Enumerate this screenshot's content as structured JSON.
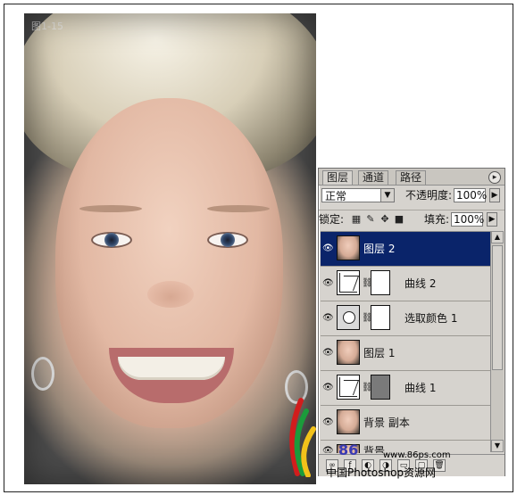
{
  "photo": {
    "label": "图1-15"
  },
  "layers_panel": {
    "tabs": [
      {
        "label": "图层",
        "active": true
      },
      {
        "label": "通道",
        "active": false
      },
      {
        "label": "路径",
        "active": false
      }
    ],
    "menu_icon": "panel-menu-icon",
    "blend_mode": "正常",
    "opacity_label": "不透明度:",
    "opacity_value": "100%",
    "lock_label": "锁定:",
    "fill_label": "填充:",
    "fill_value": "100%",
    "layers": [
      {
        "name": "图层 2",
        "type": "photo",
        "selected": true
      },
      {
        "name": "曲线 2",
        "type": "curves",
        "mask": "white"
      },
      {
        "name": "选取颜色 1",
        "type": "selective-color",
        "mask": "white"
      },
      {
        "name": "图层 1",
        "type": "photo"
      },
      {
        "name": "曲线 1",
        "type": "curves",
        "mask": "gray"
      },
      {
        "name": "背景 副本",
        "type": "photo"
      },
      {
        "name": "背景",
        "type": "photo"
      }
    ]
  },
  "watermark": {
    "number": "86",
    "url": "www.86ps.com",
    "site_name": "中国Photoshop资源网"
  }
}
